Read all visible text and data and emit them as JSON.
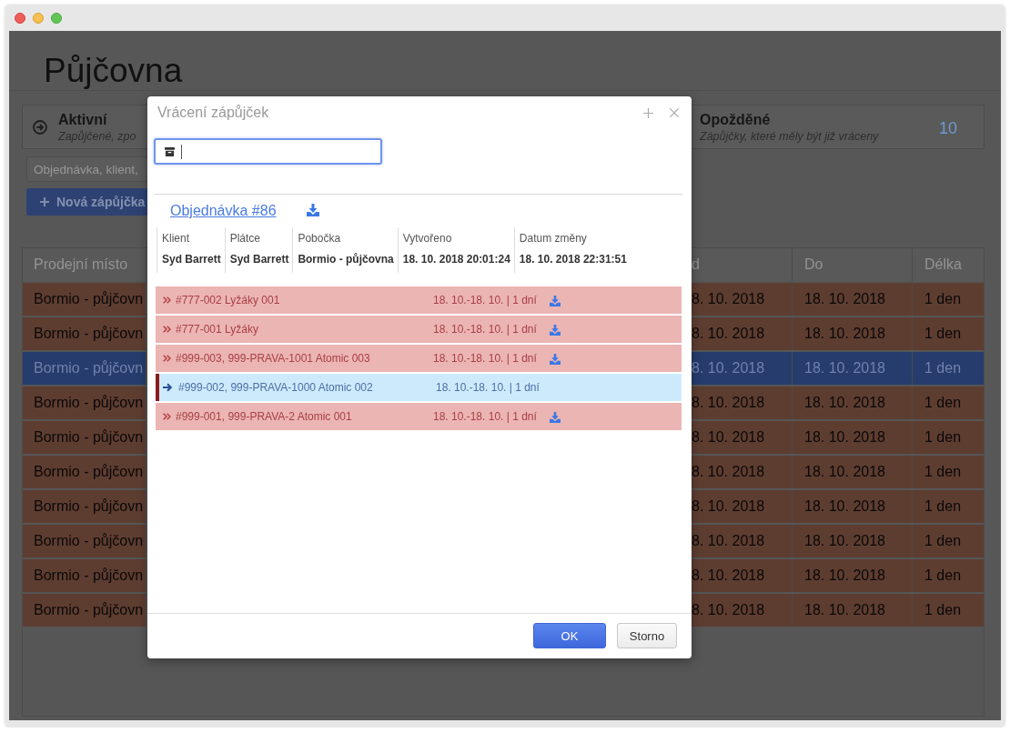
{
  "page": {
    "title": "Půjčovna"
  },
  "filters": [
    {
      "title": "Aktivní",
      "subtitle": "Zapůjčené, zpo"
    },
    {
      "title": "Opožděné",
      "subtitle": "Zápůjčky, které měly být již vráceny",
      "count": "10"
    }
  ],
  "search": {
    "placeholder": "Objednávka, klient,"
  },
  "new_button": {
    "label": "Nová zápůjčka"
  },
  "table": {
    "columns": [
      "Prodejní místo",
      "d",
      "Do",
      "Délka"
    ],
    "rows": [
      {
        "cells": [
          "Bormio - půjčovn",
          "8. 10. 2018",
          "18. 10. 2018",
          "1 den"
        ],
        "selected": false
      },
      {
        "cells": [
          "Bormio - půjčovn",
          "8. 10. 2018",
          "18. 10. 2018",
          "1 den"
        ],
        "selected": false
      },
      {
        "cells": [
          "Bormio - půjčovn",
          "8. 10. 2018",
          "18. 10. 2018",
          "1 den"
        ],
        "selected": true
      },
      {
        "cells": [
          "Bormio - půjčovn",
          "8. 10. 2018",
          "18. 10. 2018",
          "1 den"
        ],
        "selected": false
      },
      {
        "cells": [
          "Bormio - půjčovn",
          "8. 10. 2018",
          "18. 10. 2018",
          "1 den"
        ],
        "selected": false
      },
      {
        "cells": [
          "Bormio - půjčovn",
          "8. 10. 2018",
          "18. 10. 2018",
          "1 den"
        ],
        "selected": false
      },
      {
        "cells": [
          "Bormio - půjčovn",
          "8. 10. 2018",
          "18. 10. 2018",
          "1 den"
        ],
        "selected": false
      },
      {
        "cells": [
          "Bormio - půjčovn",
          "8. 10. 2018",
          "18. 10. 2018",
          "1 den"
        ],
        "selected": false
      },
      {
        "cells": [
          "Bormio - půjčovn",
          "8. 10. 2018",
          "18. 10. 2018",
          "1 den"
        ],
        "selected": false
      },
      {
        "cells": [
          "Bormio - půjčovn",
          "8. 10. 2018",
          "18. 10. 2018",
          "1 den"
        ],
        "selected": false
      }
    ]
  },
  "dialog": {
    "title": "Vrácení zápůjček",
    "scan_field": {
      "focused": true
    },
    "order": {
      "link": "Objednávka #86",
      "info": [
        {
          "label": "Klient",
          "value": "Syd Barrett"
        },
        {
          "label": "Plátce",
          "value": "Syd Barrett"
        },
        {
          "label": "Pobočka",
          "value": "Bormio - půjčovna"
        },
        {
          "label": "Vytvořeno",
          "value": "18. 10. 2018 20:01:24"
        },
        {
          "label": "Datum změny",
          "value": "18. 10. 2018 22:31:51"
        }
      ]
    },
    "items": [
      {
        "label": "#777-002 Lyžáky 001",
        "dates": "18. 10.-18. 10. | 1 dní",
        "selected": false,
        "download": true
      },
      {
        "label": "#777-001 Lyžáky",
        "dates": "18. 10.-18. 10. | 1 dní",
        "selected": false,
        "download": true
      },
      {
        "label": "#999-003, 999-PRAVA-1001 Atomic 003",
        "dates": "18. 10.-18. 10. | 1 dní",
        "selected": false,
        "download": true
      },
      {
        "label": "#999-002, 999-PRAVA-1000 Atomic 002",
        "dates": "18. 10.-18. 10. | 1 dní",
        "selected": true,
        "download": false
      },
      {
        "label": "#999-001, 999-PRAVA-2 Atomic 001",
        "dates": "18. 10.-18. 10. | 1 dní",
        "selected": false,
        "download": true
      }
    ],
    "buttons": [
      {
        "label": "OK",
        "kind": "primary"
      },
      {
        "label": "Storno",
        "kind": "default"
      }
    ]
  }
}
